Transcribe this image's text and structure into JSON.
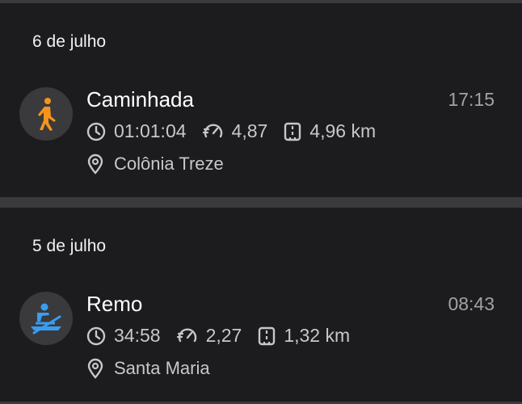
{
  "activities": [
    {
      "date": "6 de julho",
      "type": "Caminhada",
      "time": "17:15",
      "duration": "01:01:04",
      "pace": "4,87",
      "distance": "4,96 km",
      "location": "Colônia Treze",
      "icon": "walking-icon",
      "accent": "#f7941d"
    },
    {
      "date": "5 de julho",
      "type": "Remo",
      "time": "08:43",
      "duration": "34:58",
      "pace": "2,27",
      "distance": "1,32 km",
      "location": "Santa Maria",
      "icon": "rowing-icon",
      "accent": "#3b9cf0"
    }
  ]
}
